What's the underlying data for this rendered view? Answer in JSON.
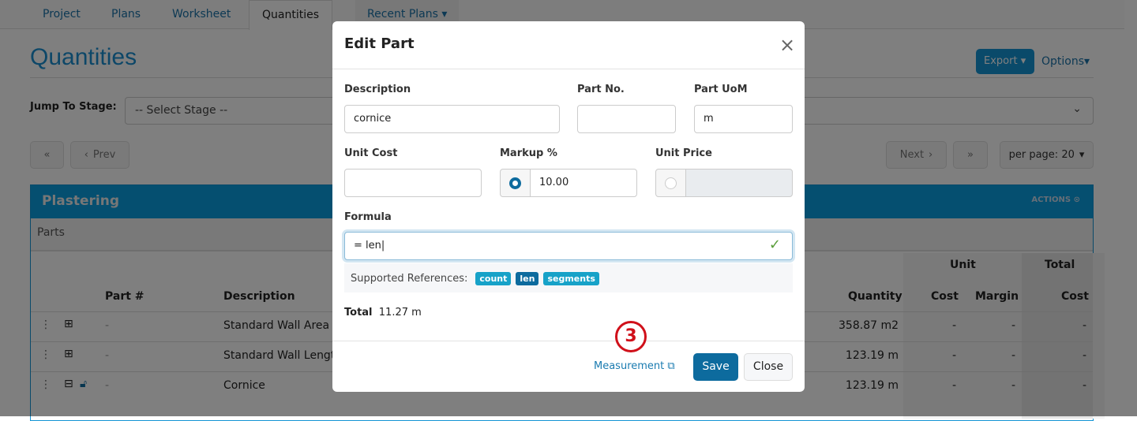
{
  "tabs": [
    {
      "label": "Project"
    },
    {
      "label": "Plans"
    },
    {
      "label": "Worksheet"
    },
    {
      "label": "Quantities"
    },
    {
      "label": "Recent Plans"
    }
  ],
  "page": {
    "title": "Quantities",
    "export_label": "Export",
    "options_label": "Options",
    "jump_label": "Jump To Stage:",
    "stage_placeholder": "-- Select Stage --",
    "prev_label": "Prev",
    "next_label": "Next",
    "per_page_label": "per page: 20"
  },
  "panel": {
    "title": "Plastering",
    "actions_label": "ACTIONS",
    "section": "Parts",
    "headers": {
      "part_no": "Part #",
      "description": "Description",
      "quantity": "Quantity",
      "unit": "Unit",
      "unit_cost": "Cost",
      "margin": "Margin",
      "total": "Total",
      "total_cost": "Cost"
    },
    "rows": [
      {
        "part_no": "-",
        "description": "Standard Wall Area T",
        "quantity": "358.87 m2",
        "cost": "-",
        "margin": "-",
        "total": "-"
      },
      {
        "part_no": "-",
        "description": "Standard Wall Lengt",
        "quantity": "123.19 m",
        "cost": "-",
        "margin": "-",
        "total": "-"
      },
      {
        "part_no": "-",
        "description": "Cornice",
        "quantity": "123.19 m",
        "cost": "-",
        "margin": "-",
        "total": "-"
      }
    ]
  },
  "modal": {
    "title": "Edit Part",
    "description_label": "Description",
    "description_value": "cornice",
    "part_no_label": "Part No.",
    "part_no_value": "",
    "uom_label": "Part UoM",
    "uom_value": "m",
    "unit_cost_label": "Unit Cost",
    "unit_cost_value": "",
    "markup_label": "Markup %",
    "markup_value": "10.00",
    "unit_price_label": "Unit Price",
    "unit_price_value": "",
    "formula_label": "Formula",
    "formula_value": "= len",
    "supported_label": "Supported References:",
    "references": [
      "count",
      "len",
      "segments"
    ],
    "total_label": "Total",
    "total_value": "11.27 m",
    "measurement_link": "Measurement",
    "save_label": "Save",
    "close_label": "Close",
    "step_marker": "3"
  },
  "colors": {
    "primary": "#0d6b9e",
    "tag": "#17a2c8",
    "tag_active": "#0d6b9e",
    "marker": "#d0101a",
    "valid": "#5a9e3a"
  }
}
